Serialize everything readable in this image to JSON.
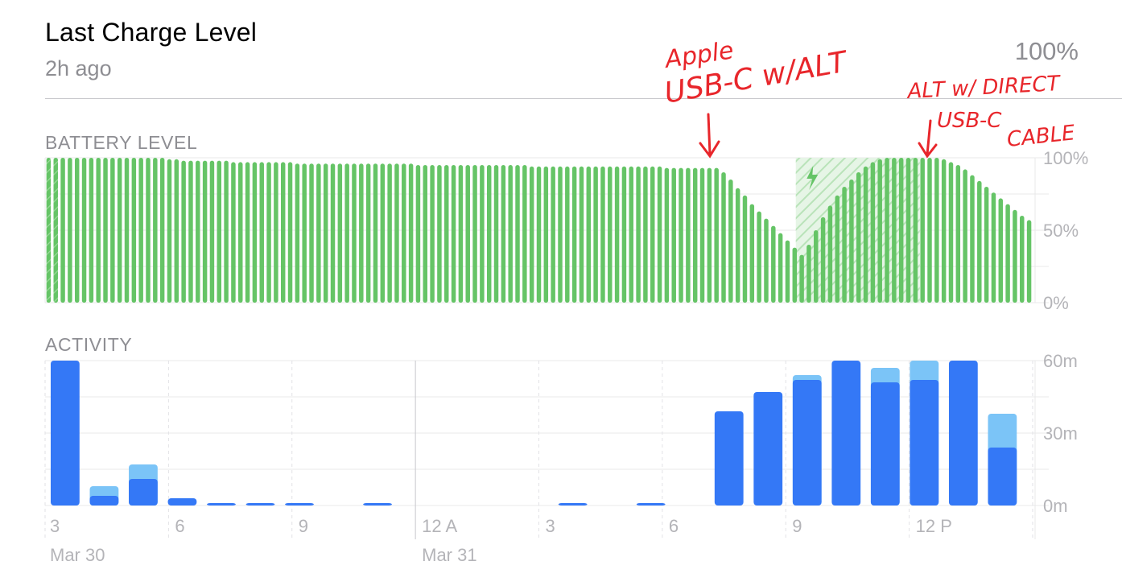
{
  "header": {
    "title": "Last Charge Level",
    "subtitle": "2h ago",
    "value": "100%"
  },
  "sections": {
    "battery_label": "BATTERY LEVEL",
    "activity_label": "ACTIVITY"
  },
  "annotations": {
    "left_line1": "Apple",
    "left_line2": "USB-C w/ALT",
    "right_line1": "ALT w/ DIRECT",
    "right_line2": "USB-C",
    "right_line3": "CABLE"
  },
  "colors": {
    "battery": "#65c466",
    "charging_hatch": "#bfe6bf",
    "screen_on": "#3478f6",
    "screen_off": "#7bc4f7",
    "annotation": "#e8262b"
  },
  "chart_data": [
    {
      "type": "bar",
      "name": "battery",
      "y_tick_labels": [
        "100%",
        "50%",
        "0%"
      ],
      "ylim": [
        0,
        100
      ],
      "grid": true,
      "values": [
        100,
        100,
        100,
        100,
        100,
        100,
        100,
        100,
        100,
        100,
        100,
        100,
        100,
        100,
        100,
        100,
        100,
        99,
        99,
        98,
        98,
        98,
        98,
        98,
        98,
        98,
        97,
        97,
        97,
        97,
        97,
        97,
        97,
        97,
        97,
        96,
        96,
        96,
        96,
        96,
        96,
        96,
        96,
        96,
        96,
        96,
        96,
        96,
        96,
        96,
        96,
        96,
        95,
        95,
        95,
        95,
        95,
        95,
        95,
        95,
        95,
        95,
        95,
        95,
        95,
        95,
        95,
        95,
        94,
        94,
        94,
        94,
        94,
        94,
        94,
        94,
        94,
        94,
        94,
        94,
        94,
        94,
        94,
        94,
        94,
        94,
        94,
        93,
        93,
        93,
        93,
        93,
        93,
        93,
        93,
        90,
        85,
        79,
        74,
        68,
        63,
        58,
        53,
        48,
        43,
        38,
        33,
        40,
        50,
        59,
        67,
        74,
        80,
        85,
        90,
        94,
        97,
        99,
        100,
        100,
        100,
        100,
        100,
        100,
        100,
        100,
        99,
        97,
        95,
        92,
        88,
        84,
        80,
        76,
        72,
        68,
        64,
        60,
        57
      ],
      "charging_range": [
        106,
        123
      ]
    },
    {
      "type": "bar",
      "name": "activity",
      "y_tick_labels": [
        "60m",
        "30m",
        "0m"
      ],
      "ylim": [
        0,
        60
      ],
      "grid": true,
      "x_tick_labels": [
        "3",
        "6",
        "9",
        "12 A",
        "3",
        "6",
        "9",
        "12 P"
      ],
      "date_labels": [
        "Mar 30",
        "Mar 31"
      ],
      "series": [
        {
          "name": "screen_on",
          "values": [
            60,
            4,
            11,
            3,
            1,
            1,
            1,
            0,
            1,
            0,
            0,
            0,
            0,
            1,
            0,
            1,
            0,
            39,
            47,
            52,
            60,
            51,
            52,
            60,
            24
          ]
        },
        {
          "name": "screen_off",
          "values": [
            0,
            4,
            6,
            0,
            0,
            0,
            0,
            0,
            0,
            0,
            0,
            0,
            0,
            0,
            0,
            0,
            0,
            0,
            0,
            2,
            0,
            6,
            8,
            0,
            14
          ]
        }
      ]
    }
  ]
}
